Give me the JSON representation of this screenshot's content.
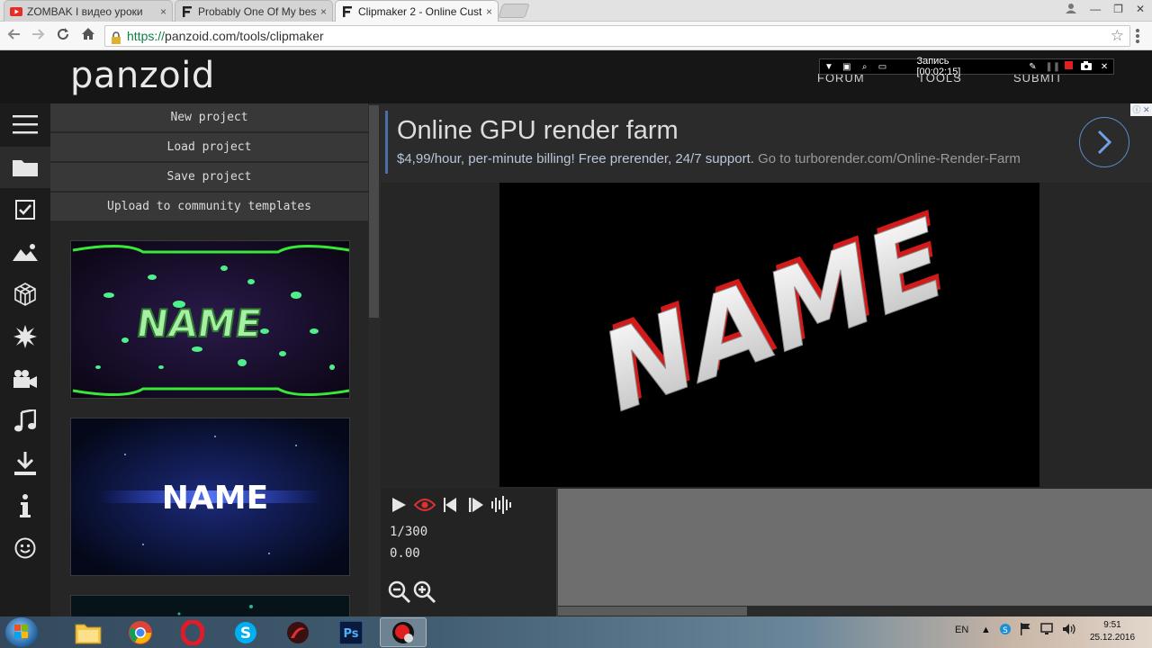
{
  "browser": {
    "tabs": [
      {
        "title": "ZOMBAK I видео уроки",
        "close": "×"
      },
      {
        "title": "Probably One Of My best",
        "close": "×"
      },
      {
        "title": "Clipmaker 2 - Online Cust",
        "close": "×"
      }
    ],
    "url_scheme": "https://",
    "url_rest": "panzoid.com/tools/clipmaker",
    "window_controls": [
      "—",
      "❐",
      "✕"
    ]
  },
  "site": {
    "logo": "panzoid",
    "nav": [
      "FORUM",
      "TOOLS",
      "SUBMIT"
    ]
  },
  "recorder": {
    "label": "Запись [00:02:15]"
  },
  "project_menu": {
    "new": "New project",
    "load": "Load project",
    "save": "Save project",
    "upload": "Upload to community templates"
  },
  "templates": [
    {
      "name": "NAME",
      "theme": "green-splatter"
    },
    {
      "name": "NAME",
      "theme": "blue-glow"
    },
    {
      "name": "",
      "theme": "teal-particles"
    }
  ],
  "ad": {
    "headline": "Online GPU render farm",
    "description": "$4,99/hour, per-minute billing! Free prerender, 24/7 support.",
    "link": "Go to turborender.com/Online-Render-Farm"
  },
  "preview": {
    "text": "NAME",
    "colors": {
      "face": "#e8e8e8",
      "side": "#d11a1a"
    }
  },
  "timeline": {
    "frame": "1/300",
    "time": "0.00"
  },
  "taskbar": {
    "language": "EN",
    "time": "9:51",
    "date": "25.12.2016"
  }
}
